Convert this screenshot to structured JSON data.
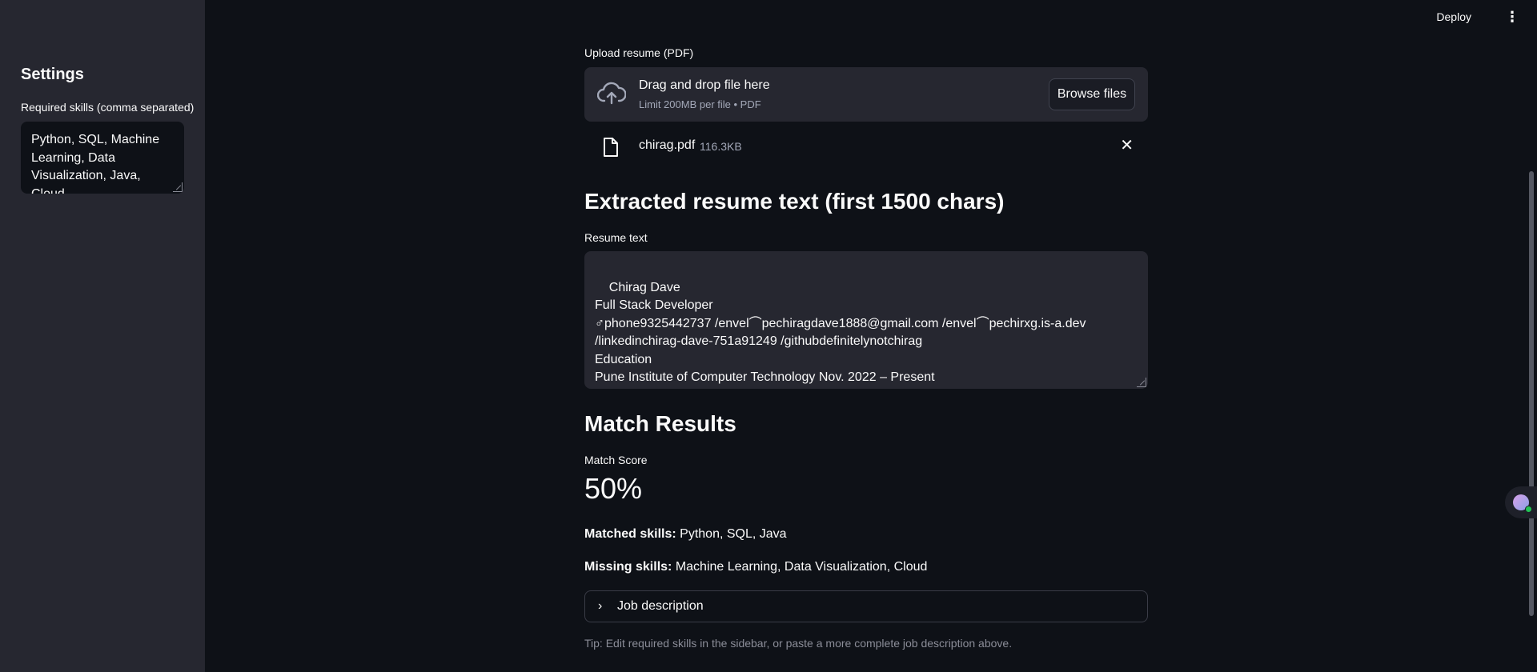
{
  "topbar": {
    "deploy_label": "Deploy",
    "menu_icon": "⋮"
  },
  "sidebar": {
    "title": "Settings",
    "skills_label": "Required skills (comma separated)",
    "skills_value": "Python, SQL, Machine Learning, Data Visualization, Java, Cloud"
  },
  "upload": {
    "label": "Upload resume (PDF)",
    "drop_title": "Drag and drop file here",
    "drop_sub": "Limit 200MB per file • PDF",
    "browse_label": "Browse files",
    "file_name": "chirag.pdf",
    "file_size": "116.3KB"
  },
  "extracted": {
    "heading": "Extracted resume text (first 1500 chars)",
    "label": "Resume text",
    "text": "Chirag Dave\nFull Stack Developer\n♂phone9325442737 /envel⌒pechiragdave1888@gmail.com /envel⌒pechirxg.is-a.dev\n/linkedinchirag-dave-751a91249 /githubdefinitelynotchirag\nEducation\nPune Institute of Computer Technology Nov. 2022 – Present\nBachelor of Technology in Electronics And Telecommunication Pune, Maharashtra"
  },
  "results": {
    "heading": "Match Results",
    "metric_label": "Match Score",
    "metric_value": "50%",
    "matched_label": "Matched skills:",
    "matched_value": "Python, SQL, Java",
    "missing_label": "Missing skills:",
    "missing_value": "Machine Learning, Data Visualization, Cloud"
  },
  "expander": {
    "label": "Job description",
    "icon": "chevron-right-icon"
  },
  "tip": "Tip: Edit required skills in the sidebar, or paste a more complete job description above."
}
